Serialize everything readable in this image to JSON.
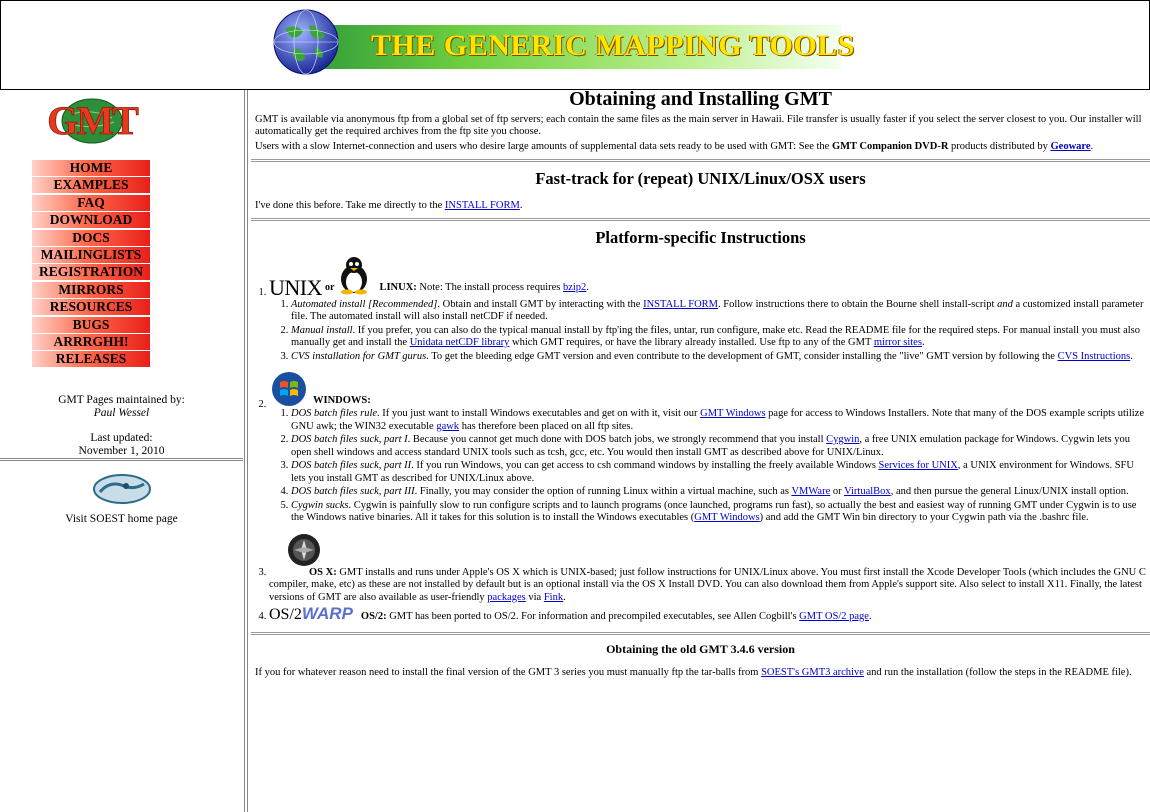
{
  "banner": {
    "title": "THE GENERIC MAPPING TOOLS"
  },
  "logo": {
    "text": "GMT"
  },
  "nav": [
    {
      "label": "HOME"
    },
    {
      "label": "EXAMPLES"
    },
    {
      "label": "FAQ"
    },
    {
      "label": "DOWNLOAD"
    },
    {
      "label": "DOCS"
    },
    {
      "label": "MAILINGLISTS"
    },
    {
      "label": "REGISTRATION"
    },
    {
      "label": "MIRRORS"
    },
    {
      "label": "RESOURCES"
    },
    {
      "label": "BUGS"
    },
    {
      "label": "ARRRGHH!"
    },
    {
      "label": "RELEASES"
    }
  ],
  "maintainer": {
    "line1": "GMT Pages maintained by:",
    "name": "Paul Wessel",
    "updated_label": "Last updated:",
    "updated_date": "November 1, 2010"
  },
  "soest": {
    "label": "Visit SOEST home page"
  },
  "main": {
    "title": "Obtaining and Installing GMT",
    "intro1": "GMT is available via anonymous ftp from a global set of ftp servers; each contain the same files as the main server in Hawaii. File transfer is usually faster if you select the server closest to you. Our installer will automatically get the required archives from the ftp site you choose.",
    "intro2_pre": "Users with a slow Internet-connection and users who desire large amounts of supplemental data sets ready to be used with GMT: See the ",
    "intro2_bold": "GMT Companion DVD-R",
    "intro2_mid": " products distributed by ",
    "intro2_link": "Geoware",
    "intro2_post": ".",
    "fast_title": "Fast-track for (repeat) UNIX/Linux/OSX users",
    "fast_pre": "I've done this before. Take me directly to the ",
    "fast_link": "INSTALL FORM",
    "fast_post": ".",
    "platform_title": "Platform-specific Instructions",
    "unix": {
      "logo_unix": "UNIX",
      "logo_or": "or",
      "head": "LINUX:",
      "note_pre": " Note: The install process requires ",
      "note_link": "bzip2",
      "note_post": ".",
      "i1_em": "Automated install [Recommended]",
      "i1_a": ". Obtain and install GMT by interacting with the ",
      "i1_link": "INSTALL FORM",
      "i1_b": ". Follow instructions there to obtain the Bourne shell install-script ",
      "i1_em2": "and",
      "i1_c": " a customized install parameter file. The automated install will also install netCDF if needed.",
      "i2_em": "Manual install",
      "i2_a": ". If you prefer, you can also do the typical manual install by ftp'ing the files, untar, run configure, make etc. Read the README file for the required steps. For manual install you must also manually get and install the ",
      "i2_link": "Unidata netCDF library",
      "i2_b": " which GMT requires, or have the library already installed. Use ftp to any of the GMT ",
      "i2_link2": "mirror sites",
      "i2_c": ".",
      "i3_em": "CVS installation for GMT gurus",
      "i3_a": ". To get the bleeding edge GMT version and even contribute to the development of GMT, consider installing the \"live\" GMT version by following the ",
      "i3_link": "CVS Instructions",
      "i3_b": "."
    },
    "windows": {
      "head": "WINDOWS:",
      "i1_em": "DOS batch files rule",
      "i1_a": ". If you just want to install Windows executables and get on with it, visit our ",
      "i1_link": "GMT Windows",
      "i1_b": " page for access to Windows Installers. Note that many of the DOS example scripts utilize GNU awk; the WIN32 executable ",
      "i1_link2": "gawk",
      "i1_c": " has therefore been placed on all ftp sites.",
      "i2_em": "DOS batch files suck, part I",
      "i2_a": ". Because you cannot get much done with DOS batch jobs, we strongly recommend that you install ",
      "i2_link": "Cygwin",
      "i2_b": ", a free UNIX emulation package for Windows. Cygwin lets you open shell windows and access standard UNIX tools such as tcsh, gcc, etc. You would then install GMT as described above for UNIX/Linux.",
      "i3_em": "DOS batch files suck, part II",
      "i3_a": ". If you run Windows, you can get access to csh command windows by installing the freely available Windows ",
      "i3_link": "Services for UNIX",
      "i3_b": ", a UNIX environment for Windows. SFU lets you install GMT as described for UNIX/Linux above.",
      "i4_em": "DOS batch files suck, part III",
      "i4_a": ". Finally, you may consider the option of running Linux within a virtual machine, such as ",
      "i4_link": "VMWare",
      "i4_b": " or ",
      "i4_link2": "VirtualBox",
      "i4_c": ", and then pursue the general Linux/UNIX install option.",
      "i5_em": "Cygwin sucks",
      "i5_a": ". Cygwin is painfully slow to run configure scripts and to launch programs (once launched, programs run fast), so actually the best and easiest way of running GMT under Cygwin is to use the Windows native binaries. All it takes for this solution is to install the Windows executables (",
      "i5_link": "GMT Windows",
      "i5_b": ") and add the GMT Win bin directory to your Cygwin path via the .bashrc file."
    },
    "osx": {
      "head": "OS X:",
      "a": " GMT installs and runs under Apple's OS X which is UNIX-based; just follow instructions for UNIX/Linux above. You must first install the Xcode Developer Tools (which includes the GNU C compiler, make, etc) as these are not installed by default but is an optional install via the OS X Install DVD. You can also download them from Apple's support site. Also select to install X11. Finally, the latest versions of GMT are also available as user-friendly ",
      "link": "packages",
      "b": " via ",
      "link2": "Fink",
      "c": "."
    },
    "os2": {
      "logo_os2": "OS/2",
      "logo_warp": "WARP",
      "head": "OS/2:",
      "a": " GMT has been ported to OS/2. For information and precompiled executables, see Allen Cogbill's ",
      "link": "GMT OS/2 page",
      "b": "."
    },
    "old_title": "Obtaining the old GMT 3.4.6 version",
    "old_pre": "If you for whatever reason need to install the final version of the GMT 3 series you must manually ftp the tar-balls from ",
    "old_link": "SOEST's GMT3 archive",
    "old_post": " and run the installation (follow the steps in the README file)."
  }
}
